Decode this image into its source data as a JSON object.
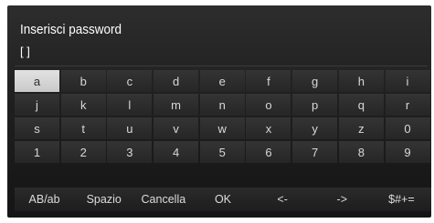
{
  "dialog": {
    "title": "Inserisci password",
    "field_value": "[ ]"
  },
  "keyboard": {
    "rows": [
      [
        "a",
        "b",
        "c",
        "d",
        "e",
        "f",
        "g",
        "h",
        "i"
      ],
      [
        "j",
        "k",
        "l",
        "m",
        "n",
        "o",
        "p",
        "q",
        "r"
      ],
      [
        "s",
        "t",
        "u",
        "v",
        "w",
        "x",
        "y",
        "z",
        "0"
      ],
      [
        "1",
        "2",
        "3",
        "4",
        "5",
        "6",
        "7",
        "8",
        "9"
      ]
    ],
    "selected_key": "a",
    "functions": [
      "AB/ab",
      "Spazio",
      "Cancella",
      "OK",
      "<-",
      "->",
      "$#+="
    ]
  },
  "colors": {
    "panel_dark": "#1f1f1f",
    "key_bg": "#2e2e2e",
    "selected_key_bg": "#d4d4d4",
    "text": "#dcdcdc"
  }
}
